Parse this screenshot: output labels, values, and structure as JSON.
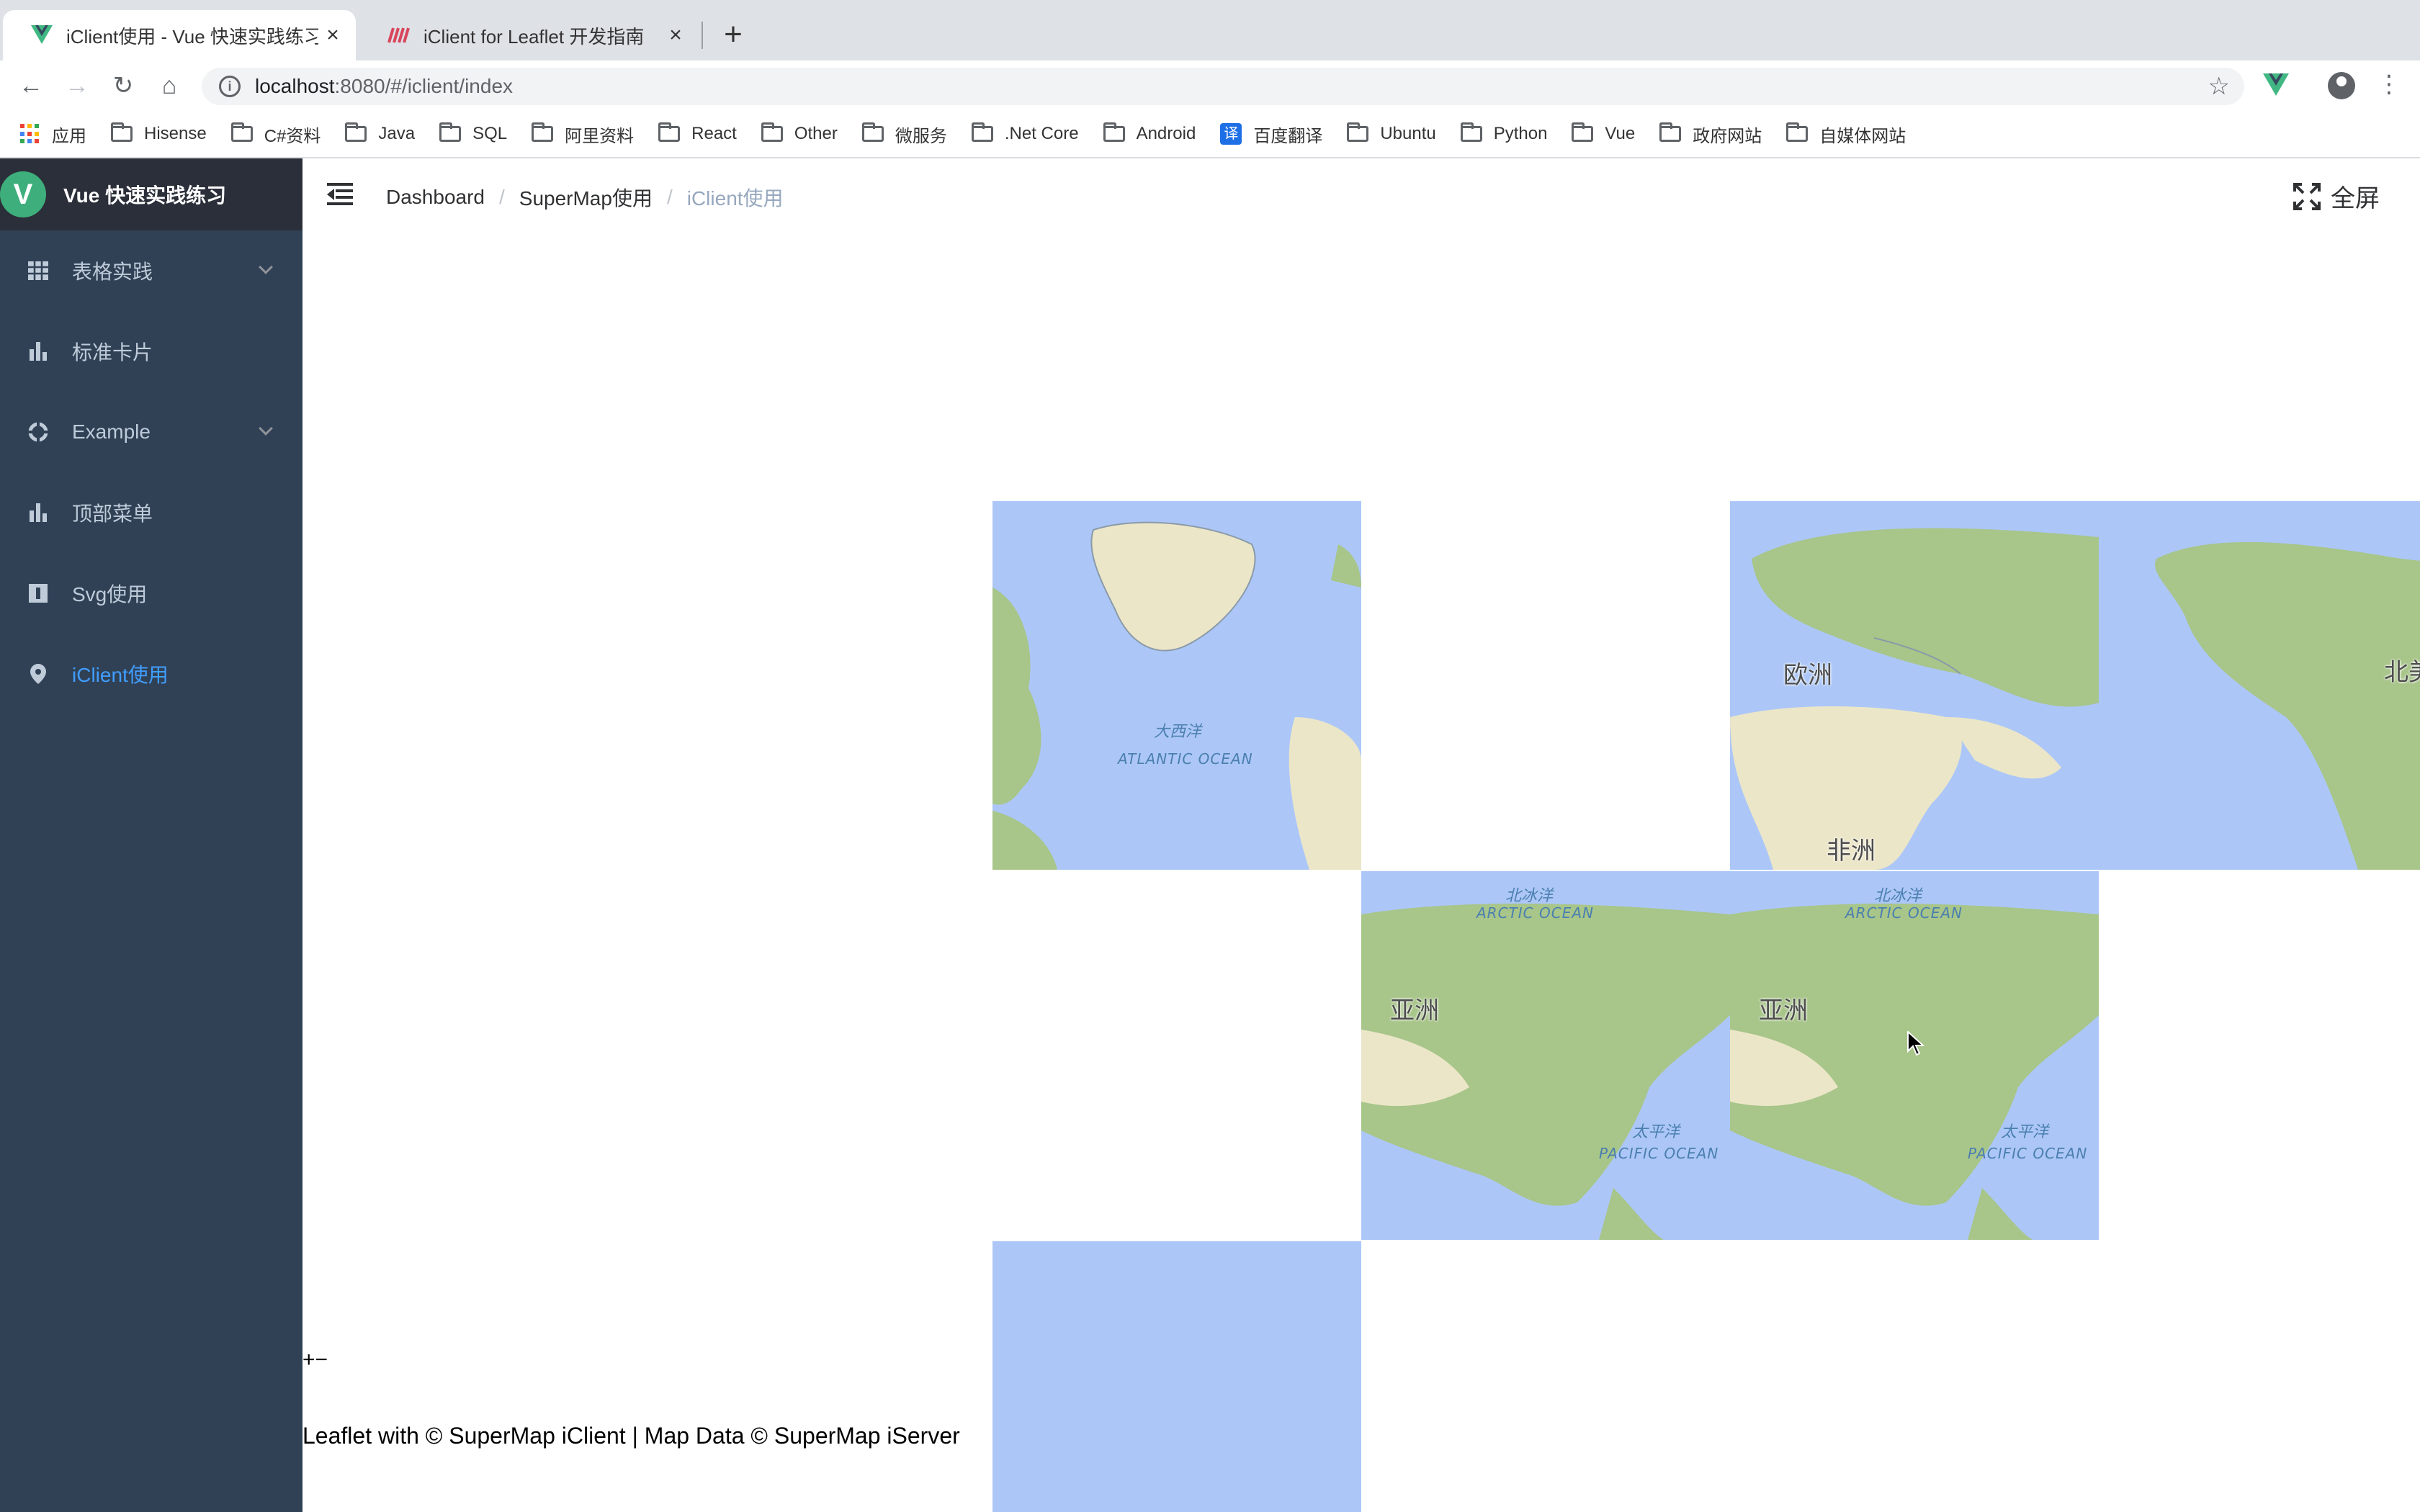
{
  "browser": {
    "tabs": [
      {
        "title": "iClient使用 - Vue 快速实践练习",
        "active": true
      },
      {
        "title": "iClient for Leaflet 开发指南",
        "active": false
      }
    ],
    "url_host": "localhost",
    "url_rest": ":8080/#/iclient/index",
    "bookmarks": [
      "应用",
      "Hisense",
      "C#资料",
      "Java",
      "SQL",
      "阿里资料",
      "React",
      "Other",
      "微服务",
      ".Net Core",
      "Android",
      "百度翻译",
      "Ubuntu",
      "Python",
      "Vue",
      "政府网站",
      "自媒体网站"
    ],
    "translate_badge": "译"
  },
  "sidebar": {
    "logo_letter": "V",
    "title": "Vue 快速实践练习",
    "items": [
      {
        "label": "表格实践",
        "icon": "table-icon",
        "expandable": true
      },
      {
        "label": "标准卡片",
        "icon": "bar-chart-icon",
        "expandable": false
      },
      {
        "label": "Example",
        "icon": "example-icon",
        "expandable": true
      },
      {
        "label": "顶部菜单",
        "icon": "bar-chart-icon",
        "expandable": false
      },
      {
        "label": "Svg使用",
        "icon": "svg-icon",
        "expandable": false
      },
      {
        "label": "iClient使用",
        "icon": "location-pin-icon",
        "expandable": false,
        "active": true
      }
    ]
  },
  "navbar": {
    "breadcrumb": [
      "Dashboard",
      "SuperMap使用",
      "iClient使用"
    ],
    "separator": "/",
    "fullscreen_label": "全屏"
  },
  "map": {
    "labels": {
      "atlantic_cn": "大西洋",
      "atlantic_en": "ATLANTIC OCEAN",
      "europe": "欧洲",
      "africa": "非洲",
      "north_america": "北美",
      "arctic_cn": "北冰洋",
      "arctic_en": "ARCTIC OCEAN",
      "asia": "亚洲",
      "pacific_cn": "太平洋",
      "pacific_en": "PACIFIC OCEAN"
    },
    "zoom_control": "+−",
    "attribution": "Leaflet with © SuperMap iClient | Map Data © SuperMap iServer"
  },
  "colors": {
    "sidebar_bg": "#304156",
    "sidebar_active": "#409eff",
    "ocean": "#acc7f7",
    "land_green": "#a8c58a",
    "land_desert": "#ece6c8"
  }
}
